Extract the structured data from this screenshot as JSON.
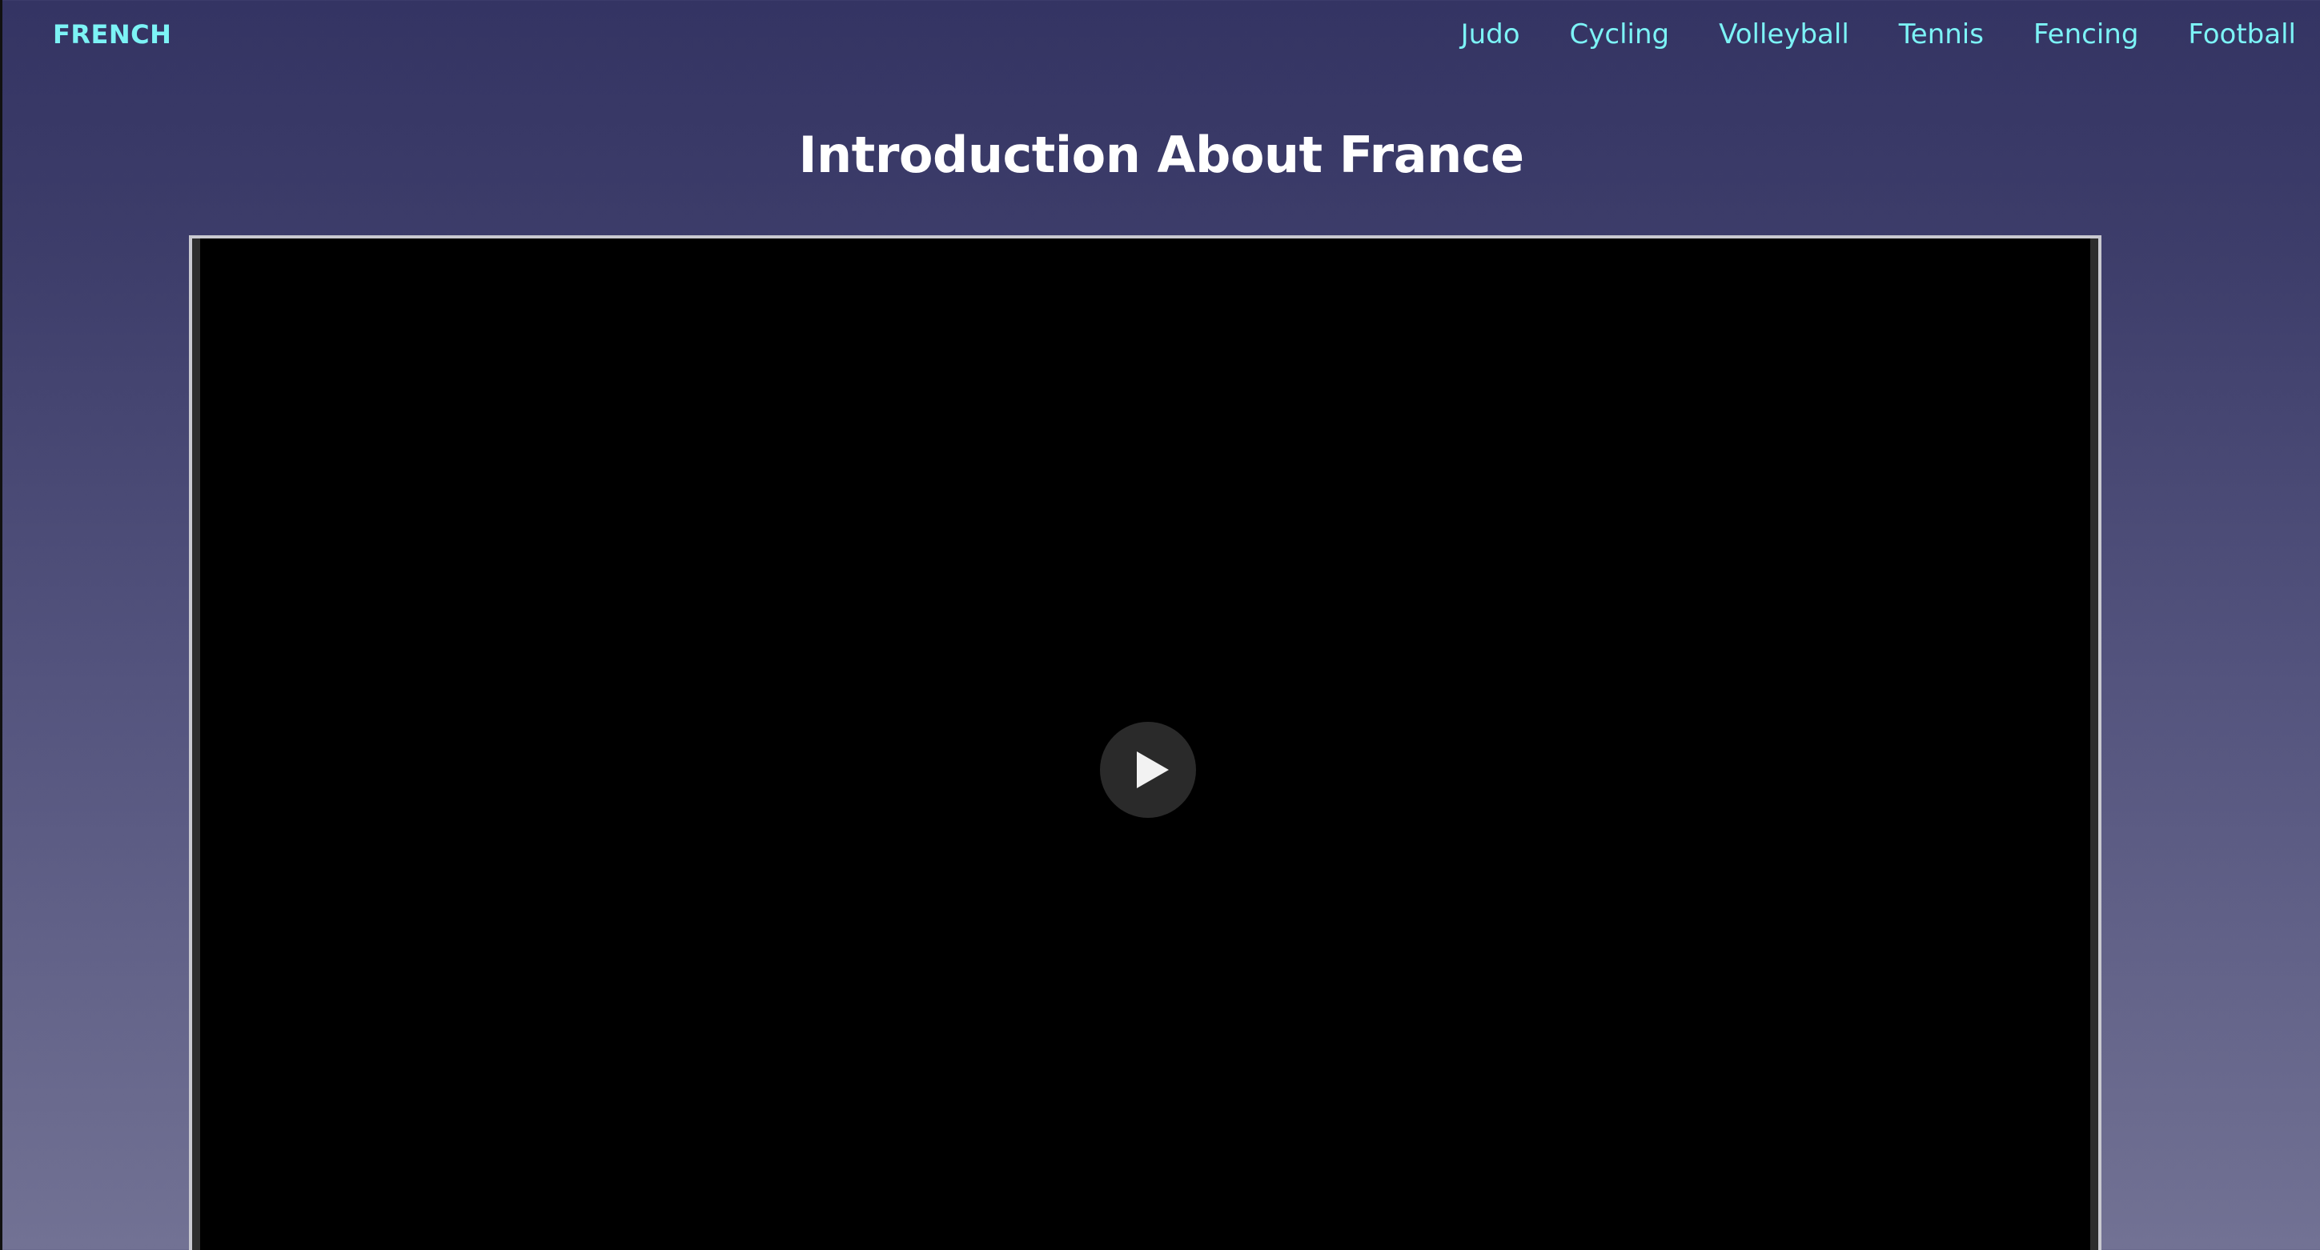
{
  "header": {
    "brand": "FRENCH",
    "nav": [
      {
        "label": "Judo"
      },
      {
        "label": "Cycling"
      },
      {
        "label": "Volleyball"
      },
      {
        "label": "Tennis"
      },
      {
        "label": "Fencing"
      },
      {
        "label": "Football"
      }
    ]
  },
  "main": {
    "title": "Introduction About France"
  },
  "icons": {
    "play": "play-icon"
  },
  "colors": {
    "accent": "#7cf3f6",
    "title": "#ffffff",
    "video_background": "#000000"
  }
}
